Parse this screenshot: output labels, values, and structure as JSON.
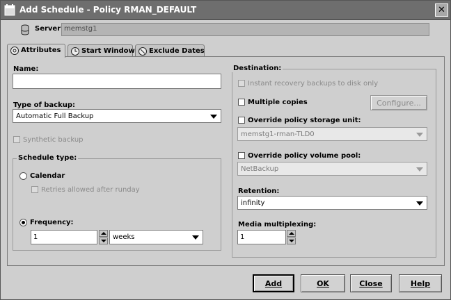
{
  "window": {
    "title": "Add Schedule - Policy RMAN_DEFAULT",
    "close_glyph": "✕"
  },
  "server": {
    "label": "Server:",
    "value": "memstg1"
  },
  "tabs": [
    {
      "label": "Attributes"
    },
    {
      "label": "Start Window"
    },
    {
      "label": "Exclude Dates"
    }
  ],
  "attributes": {
    "name": {
      "label": "Name:",
      "value": ""
    },
    "type_of_backup": {
      "label": "Type of backup:",
      "value": "Automatic Full Backup"
    },
    "synthetic_backup": {
      "label": "Synthetic backup",
      "checked": false,
      "enabled": false
    },
    "schedule_type": {
      "title": "Schedule type:",
      "calendar": {
        "label": "Calendar",
        "selected": false
      },
      "retries_after_runday": {
        "label": "Retries allowed after runday",
        "checked": false,
        "enabled": false
      },
      "frequency": {
        "label": "Frequency:",
        "selected": true,
        "value": "1",
        "unit": "weeks"
      }
    },
    "destination": {
      "title": "Destination:",
      "instant_recovery": {
        "label": "Instant recovery backups to disk only",
        "checked": false,
        "enabled": false
      },
      "multiple_copies": {
        "label": "Multiple copies",
        "checked": false
      },
      "configure_button": "Configure...",
      "override_storage_unit": {
        "label": "Override policy storage unit:",
        "checked": false,
        "value": "memstg1-rman-TLD0"
      },
      "override_volume_pool": {
        "label": "Override policy volume pool:",
        "checked": false,
        "value": "NetBackup"
      }
    },
    "retention": {
      "label": "Retention:",
      "value": "infinity"
    },
    "media_multiplexing": {
      "label": "Media multiplexing:",
      "value": "1"
    }
  },
  "buttons": {
    "add": "Add",
    "ok": "OK",
    "close": "Close",
    "help": "Help"
  },
  "colors": {
    "titlebar": "#6e6e6e",
    "dialog_bg": "#cfcfcf",
    "field_bg": "#ffffff"
  }
}
